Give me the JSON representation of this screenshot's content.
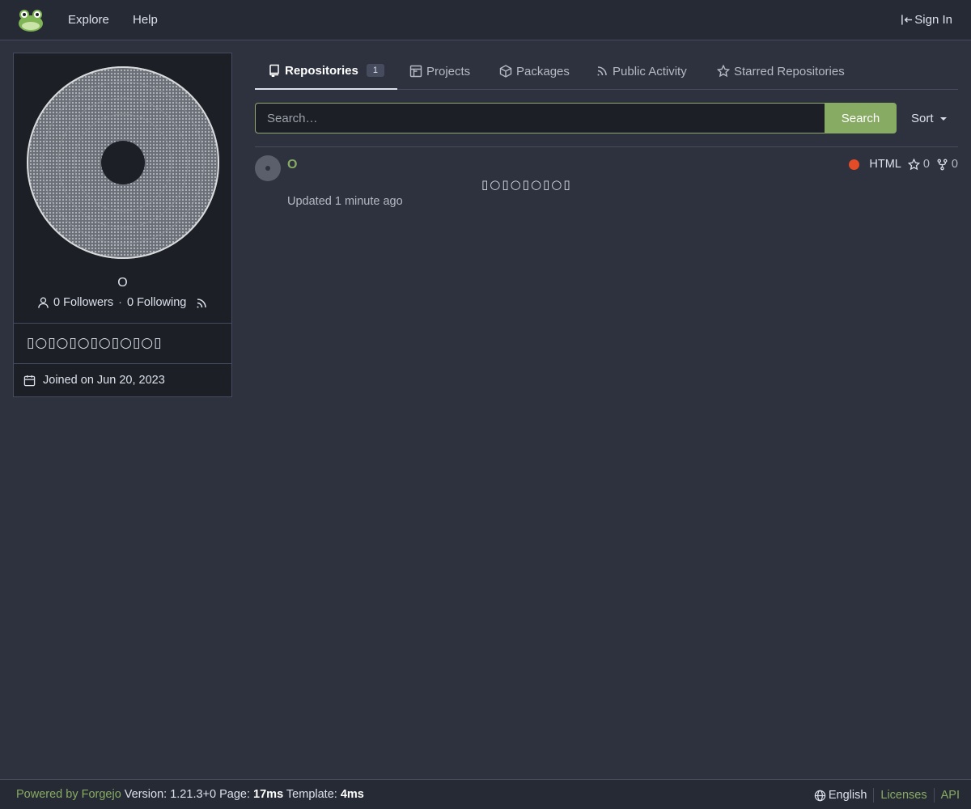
{
  "nav": {
    "explore": "Explore",
    "help": "Help",
    "sign_in": "Sign In"
  },
  "profile": {
    "name": "O",
    "followers": "0 Followers",
    "separator": "·",
    "following": "0 Following",
    "bio": "▯○▯○▯○▯○▯○▯○▯",
    "joined": "Joined on Jun 20, 2023"
  },
  "tabs": [
    {
      "label": "Repositories",
      "count": "1"
    },
    {
      "label": "Projects"
    },
    {
      "label": "Packages"
    },
    {
      "label": "Public Activity"
    },
    {
      "label": "Starred Repositories"
    }
  ],
  "search": {
    "placeholder": "Search…",
    "button": "Search",
    "sort": "Sort"
  },
  "repos": [
    {
      "name": "O",
      "description": "▯○▯○▯○▯○▯",
      "updated": "Updated 1 minute ago",
      "language": "HTML",
      "language_color": "#e34c26",
      "stars": "0",
      "forks": "0"
    }
  ],
  "footer": {
    "powered_by": "Powered by Forgejo",
    "version": "Version: 1.21.3+0",
    "page_label": "Page:",
    "page_time": "17ms",
    "template_label": "Template:",
    "template_time": "4ms",
    "language": "English",
    "licenses": "Licenses",
    "api": "API"
  },
  "colors": {
    "accent": "#87ab63",
    "background": "#2e323e",
    "navbar": "#262a34"
  }
}
